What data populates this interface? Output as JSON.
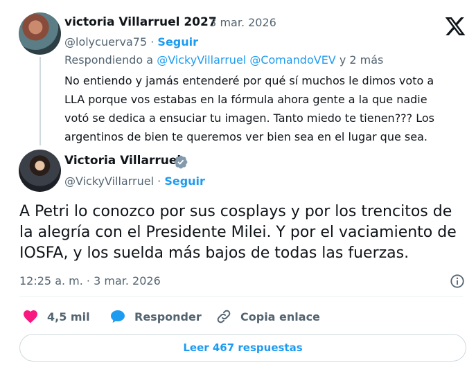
{
  "reply_tweet": {
    "display_name": "victoria Villarruel 2027",
    "date": "· 3 mar. 2026",
    "handle": "@lolycuerva75",
    "separator": "·",
    "follow_label": "Seguir",
    "replying_prefix": "Respondiendo a",
    "replying_mentions": "@VickyVillarruel @ComandoVEV",
    "replying_suffix": "y 2 más",
    "text": "No entiendo y jamás entenderé por qué sí muchos le dimos voto a LLA porque vos estabas en la fórmula ahora gente a la que nadie votó se dedica a ensuciar tu imagen. Tanto miedo te tienen??? Los argentinos de bien te queremos ver bien sea en el lugar que sea."
  },
  "main_tweet": {
    "display_name": "Victoria Villarruel",
    "handle": "@VickyVillarruel",
    "separator": "·",
    "follow_label": "Seguir",
    "text": "A Petri lo conozco por sus cosplays y por los trencitos de la alegría con el Presidente Milei. Y por el vaciamiento de IOSFA, y los suelda más bajos de todas las fuerzas.",
    "timestamp": "12:25 a. m. · 3 mar. 2026"
  },
  "actions": {
    "likes": "4,5 mil",
    "reply_label": "Responder",
    "copy_label": "Copia enlace"
  },
  "read_replies_label": "Leer 467 respuestas",
  "icons": {
    "platform": "x-logo-icon",
    "verified": "verified-badge-icon",
    "info": "info-icon",
    "like": "heart-icon",
    "reply": "speech-bubble-icon",
    "copy": "link-icon"
  },
  "colors": {
    "accent": "#1d9bf0",
    "like": "#f91880",
    "secondary_text": "#536471",
    "primary_text": "#0f1419",
    "verified_badge": "#829aab"
  }
}
